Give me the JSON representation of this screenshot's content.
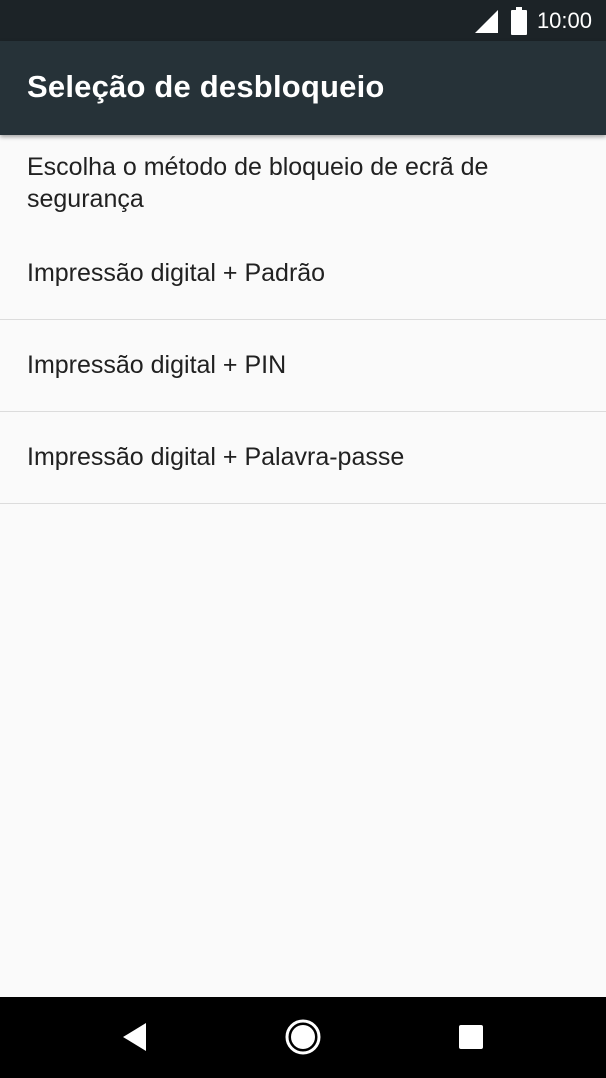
{
  "status_bar": {
    "time": "10:00",
    "icons": [
      "cell-signal-icon",
      "battery-icon"
    ]
  },
  "app_bar": {
    "title": "Seleção de desbloqueio"
  },
  "content": {
    "subheader": "Escolha o método de bloqueio de ecrã de segurança",
    "options": [
      {
        "label": "Impressão digital + Padrão"
      },
      {
        "label": "Impressão digital + PIN"
      },
      {
        "label": "Impressão digital + Palavra-passe"
      }
    ]
  },
  "nav_bar": {
    "buttons": [
      "back-icon",
      "home-icon",
      "recents-icon"
    ]
  },
  "colors": {
    "status_bar": "#1c2327",
    "app_bar": "#263238",
    "background": "#fafafa",
    "text": "#212121",
    "divider": "#dcdcdc",
    "nav_bar": "#000000"
  }
}
